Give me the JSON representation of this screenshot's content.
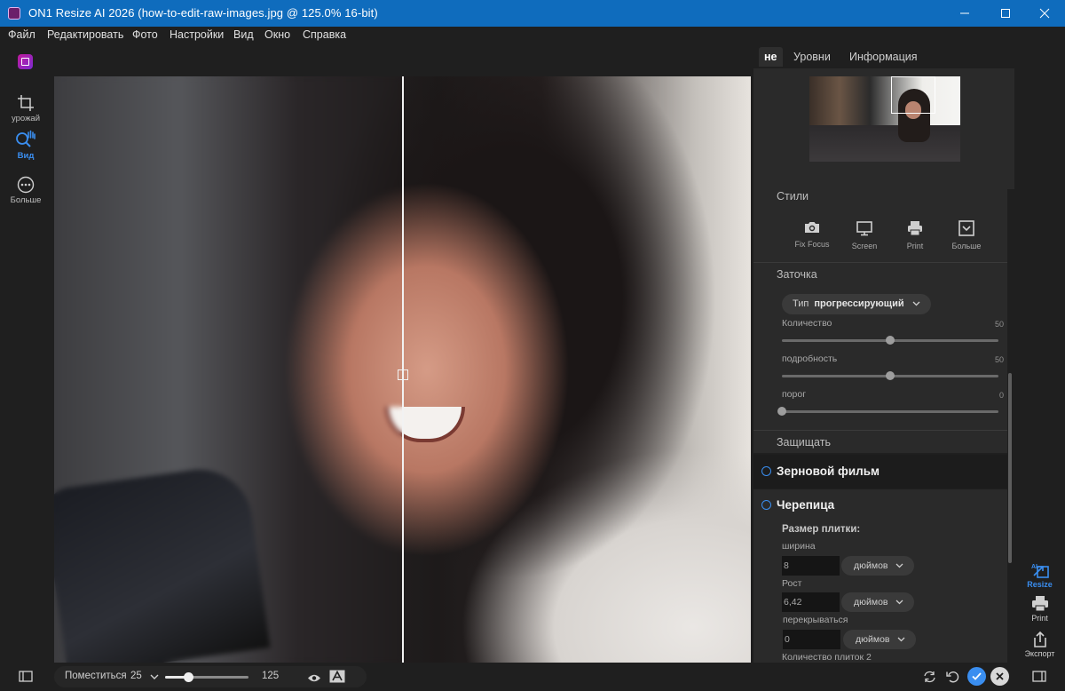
{
  "window": {
    "title": "ON1 Resize AI 2026 (how-to-edit-raw-images.jpg @ 125.0% 16-bit)",
    "controls": [
      "minimize-icon",
      "maximize-icon",
      "close-icon"
    ]
  },
  "menu": [
    "Файл",
    "Редактировать",
    "Фото",
    "Настройки",
    "Вид",
    "Окно",
    "Справка"
  ],
  "left_tools": [
    {
      "label": "урожай",
      "icon": "crop-icon",
      "active": false
    },
    {
      "label": "Вид",
      "icon": "zoom-hand-icon",
      "active": true
    },
    {
      "label": "Больше",
      "icon": "more-icon",
      "active": false
    }
  ],
  "panel": {
    "tabs": [
      "не",
      "Уровни",
      "Информация"
    ],
    "active_tab": "не",
    "styles": {
      "title": "Стили",
      "items": [
        {
          "label": "Fix Focus",
          "icon": "camera-icon"
        },
        {
          "label": "Screen",
          "icon": "monitor-icon"
        },
        {
          "label": "Print",
          "icon": "printer-icon"
        },
        {
          "label": "Больше",
          "icon": "chevron-box-icon"
        }
      ]
    },
    "sharpening": {
      "title": "Заточка",
      "type_label": "Тип",
      "type_value": "прогрессирующий",
      "sliders": [
        {
          "label": "Количество",
          "value": "50",
          "fraction": 0.5
        },
        {
          "label": "подробность",
          "value": "50",
          "fraction": 0.5
        },
        {
          "label": "порог",
          "value": "0",
          "fraction": 0.0
        }
      ]
    },
    "protect": {
      "title": "Защищать"
    },
    "film_grain": {
      "title": "Зерновой фильм"
    },
    "tiling": {
      "title": "Черепица",
      "tile_size_label": "Размер плитки:",
      "width_label": "ширина",
      "width_value": "8",
      "width_unit": "дюймов",
      "height_label": "Рост",
      "height_value": "6,42",
      "height_unit": "дюймов",
      "overlap_label": "перекрываться",
      "overlap_value": "0",
      "overlap_unit": "дюймов",
      "count_label": "Количество плиток 2"
    }
  },
  "far_right": [
    {
      "label": "Resize",
      "icon": "resize-ai-icon",
      "active": true
    },
    {
      "label": "Print",
      "icon": "printer-icon",
      "active": false
    },
    {
      "label": "Экспорт",
      "icon": "export-icon",
      "active": false
    }
  ],
  "bottom": {
    "fit_label": "Поместиться",
    "zoom_min": "25",
    "zoom_value": "125",
    "zoom_fraction": 0.28
  },
  "colors": {
    "accent": "#3a8ef0",
    "titlebar": "#0f6cbd",
    "panel_bg": "#2a2a2a",
    "app_bg": "#1f1f1f"
  }
}
